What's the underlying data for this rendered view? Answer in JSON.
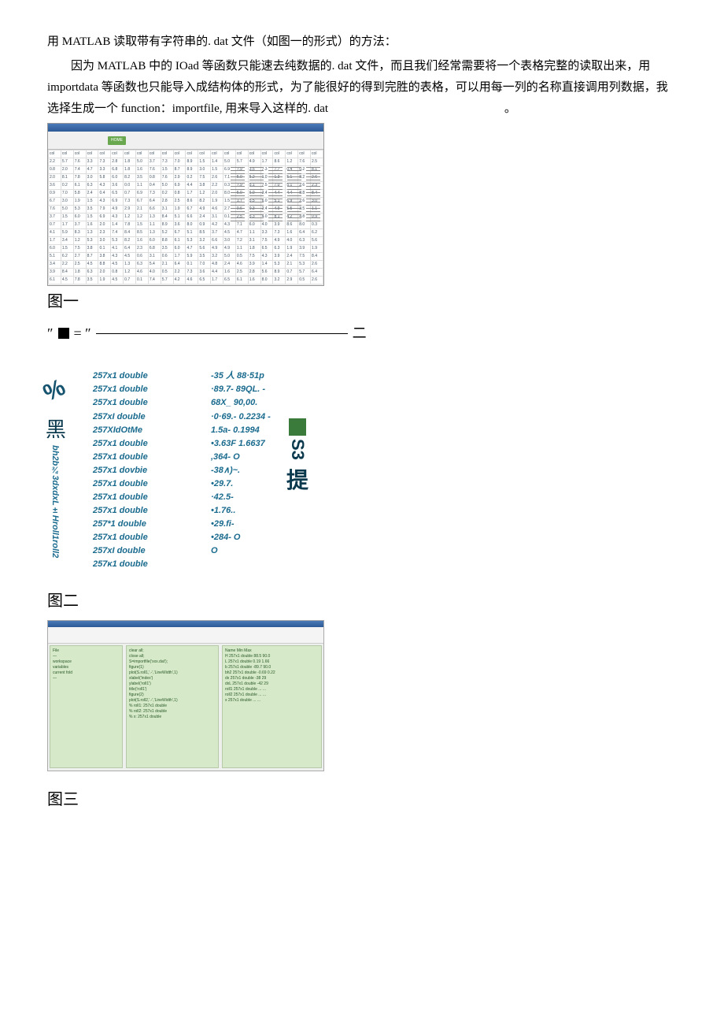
{
  "intro": {
    "p1": "用 MATLAB 读取带有字符串的. dat 文件（如图一的形式）的方法：",
    "p2": "因为 MATLAB 中的 IOad 等函数只能速去纯数据的. dat 文件，而且我们经常需要将一个表格完整的读取出来，用 importdata 等函数也只能导入成结构体的形式，为了能很好的得到完胜的表格，可以用每一列的名称直接调用列数据，我选择生成一个 function：importfile, 用来导入这样的. dat"
  },
  "fig_labels": {
    "one": "图一",
    "two": "图二",
    "three": "图三"
  },
  "eq": {
    "quote_open": "″",
    "eq": "= ″",
    "cn_two": "二"
  },
  "fig2": {
    "pct": "%",
    "black": "黑",
    "sidecode": "bh2b¾3dxdxL±Hroll1roll2",
    "types": [
      "257x1  double",
      "257x1  double",
      "257x1  double",
      "257xI double",
      "257XIdOtMe",
      "257x1 double",
      "257x1  double",
      "257x1  dovbie",
      "257x1  double",
      "257x1 double",
      "257x1  double",
      "257*1  double",
      "257x1  double",
      "257xI double",
      "257κ1 double"
    ],
    "vals": [
      "-35  人    88·51p",
      "·89.7-  89QL.  -",
      "68X_     90,00.",
      "·0·69.-  0.2234 -",
      "1.5a-    0.1994",
      "•3.63F 1.6637",
      ",364- O",
      "-38∧)~.",
      "•29.7.",
      "·42.5-",
      "•1.76..",
      "•29.fi-",
      "•284- O",
      "O"
    ],
    "s3": "S3",
    "ti": "提"
  },
  "fig3": {
    "left": [
      "File",
      "—",
      "workspace",
      "variables",
      "current fold",
      "—"
    ],
    "mid": [
      "clear all;",
      "close all;",
      "S=importfile('xxx.dat');",
      "",
      "figure(1)",
      "plot(S.roll1,'.-','LineWidth',1)",
      "xlabel('index')",
      "ylabel('roll1')",
      "title('roll1')",
      "",
      "figure(2)",
      "plot(S.roll2,'.-','LineWidth',1)",
      "",
      "% roll1: 257x1 double",
      "% roll2: 257x1 double",
      "% x: 257x1 double"
    ],
    "right": [
      "Name        Min     Max",
      "H      257x1 double   88.5  90.0",
      "L      257x1 double   0.19  1.66",
      "b      257x1 double   -89.7 90.0",
      "bh2    257x1 double   -0.69 0.22",
      "dx     257x1 double   -38   29",
      "dxL    257x1 double   -42   29",
      "roll1  257x1 double   ...   ...",
      "roll2  257x1 double   ...   ...",
      "x      257x1 double   ...   ..."
    ]
  }
}
